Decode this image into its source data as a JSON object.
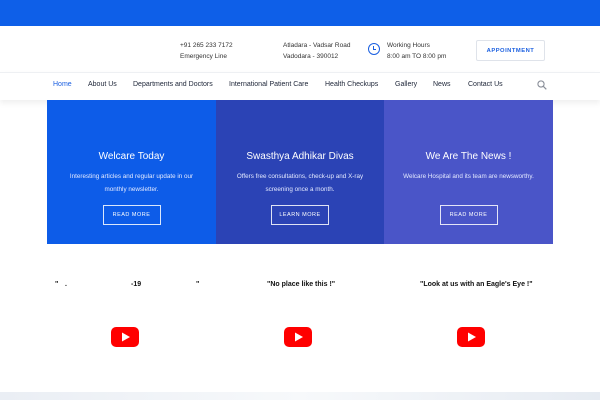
{
  "header": {
    "phone": "+91 265 233 7172",
    "phone_label": "Emergency Line",
    "address_line1": "Atladara - Vadsar Road",
    "address_line2": "Vadodara - 390012",
    "hours_label": "Working Hours",
    "hours_value": "8:00 am TO 8:00 pm",
    "appointment_label": "APPOINTMENT",
    "accent_color": "#0e5fe8"
  },
  "nav": {
    "items": [
      {
        "label": "Home",
        "active": true
      },
      {
        "label": "About Us"
      },
      {
        "label": "Departments and Doctors"
      },
      {
        "label": "International Patient Care"
      },
      {
        "label": "Health Checkups"
      },
      {
        "label": "Gallery"
      },
      {
        "label": "News"
      },
      {
        "label": "Contact Us"
      }
    ],
    "search_icon": "search-icon"
  },
  "panels": [
    {
      "title": "Welcare Today",
      "text": "Interesting articles and regular update in our monthly newsletter.",
      "button": "READ MORE",
      "color": "#0d5ce8"
    },
    {
      "title": "Swasthya Adhikar Divas",
      "text": "Offers free consultations, check-up and X-ray screening once a month.",
      "button": "LEARN MORE",
      "color": "#2b43b5"
    },
    {
      "title": "We Are The News !",
      "text": "Welcare Hospital and its team are newsworthy.",
      "button": "READ MORE",
      "color": "#4a55c8"
    }
  ],
  "videos": [
    {
      "title_part1": "\"",
      "title_part2": ".",
      "title_part3": "-19",
      "title_part4": "\""
    },
    {
      "title": "\"No place like this !\""
    },
    {
      "title": "\"Look at us with an Eagle's Eye !\""
    }
  ]
}
